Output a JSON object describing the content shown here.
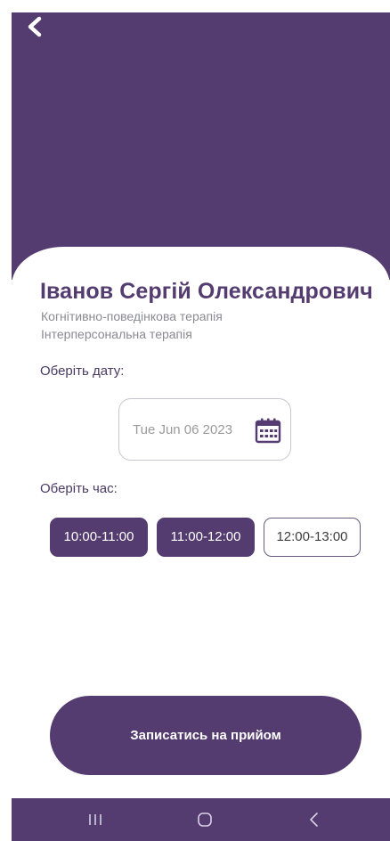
{
  "doctor": {
    "name": "Іванов Сергій Олександрович",
    "specialties": [
      "Когнітивно-поведінкова терапія",
      "Інтерперсональна терапія"
    ]
  },
  "date_section": {
    "label": "Оберіть дату:",
    "value": "Tue Jun 06 2023",
    "icon": "calendar-icon"
  },
  "time_section": {
    "label": "Оберіть час:",
    "slots": [
      {
        "label": "10:00-11:00",
        "selected": true
      },
      {
        "label": "11:00-12:00",
        "selected": true
      },
      {
        "label": "12:00-13:00",
        "selected": false
      }
    ]
  },
  "submit": {
    "label": "Записатись на прийом"
  },
  "colors": {
    "primary": "#543b70",
    "muted_text": "#8a8a92",
    "white": "#ffffff"
  },
  "navigation": {
    "back_icon": "chevron-left-icon",
    "system_buttons": [
      "recent-apps-icon",
      "home-icon",
      "back-icon"
    ]
  }
}
